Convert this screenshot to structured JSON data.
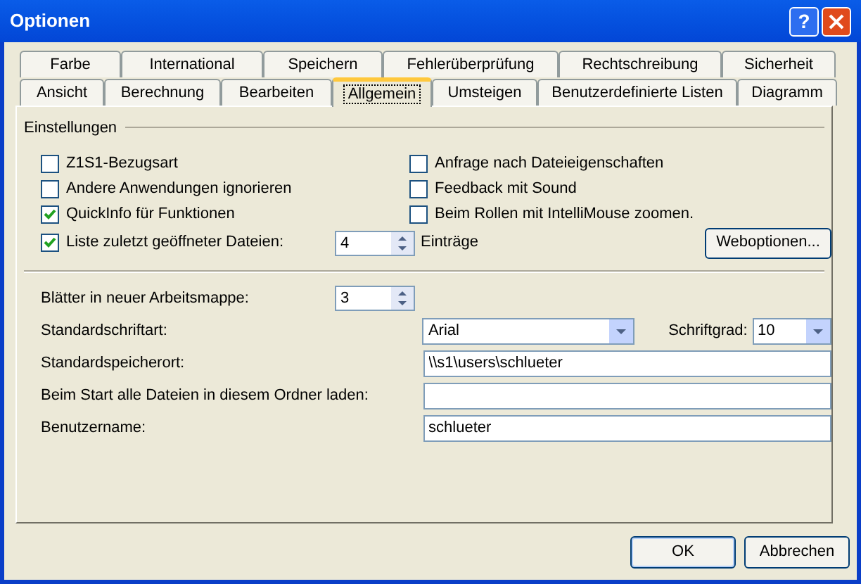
{
  "window": {
    "title": "Optionen",
    "help_glyph": "?"
  },
  "tab_rows": [
    {
      "tabs": [
        {
          "label": "Farbe",
          "selected": false
        },
        {
          "label": "International",
          "selected": false
        },
        {
          "label": "Speichern",
          "selected": false
        },
        {
          "label": "Fehlerüberprüfung",
          "selected": false
        },
        {
          "label": "Rechtschreibung",
          "selected": false
        },
        {
          "label": "Sicherheit",
          "selected": false
        }
      ]
    },
    {
      "tabs": [
        {
          "label": "Ansicht",
          "selected": false
        },
        {
          "label": "Berechnung",
          "selected": false
        },
        {
          "label": "Bearbeiten",
          "selected": false
        },
        {
          "label": "Allgemein",
          "selected": true
        },
        {
          "label": "Umsteigen",
          "selected": false
        },
        {
          "label": "Benutzerdefinierte Listen",
          "selected": false
        },
        {
          "label": "Diagramm",
          "selected": false
        }
      ]
    }
  ],
  "settings": {
    "title": "Einstellungen",
    "left_options": [
      {
        "label": "Z1S1-Bezugsart",
        "checked": false
      },
      {
        "label": "Andere Anwendungen ignorieren",
        "checked": false
      },
      {
        "label": "QuickInfo für Funktionen",
        "checked": true
      }
    ],
    "right_options": [
      {
        "label": "Anfrage nach Dateieigenschaften",
        "checked": false
      },
      {
        "label": "Feedback mit Sound",
        "checked": false
      },
      {
        "label": "Beim Rollen mit IntelliMouse zoomen.",
        "checked": false
      }
    ],
    "recent_files": {
      "label": "Liste zuletzt geöffneter Dateien:",
      "checked": true,
      "value": "4",
      "suffix": "Einträge"
    },
    "web_options_button": "Weboptionen..."
  },
  "fields": [
    {
      "kind": "spin",
      "label": "Blätter in neuer Arbeitsmappe:",
      "value": "3"
    },
    {
      "kind": "combo",
      "label": "Standardschriftart:",
      "value": "Arial",
      "size_label": "Schriftgrad:",
      "size_value": "10"
    },
    {
      "kind": "text",
      "label": "Standardspeicherort:",
      "value": "\\\\s1\\users\\schlueter"
    },
    {
      "kind": "text",
      "label": "Beim Start alle Dateien in diesem Ordner laden:"
    },
    {
      "kind": "text",
      "label": "Benutzername:",
      "value": "schlueter"
    }
  ],
  "buttons": [
    "OK",
    "Abbrechen"
  ]
}
